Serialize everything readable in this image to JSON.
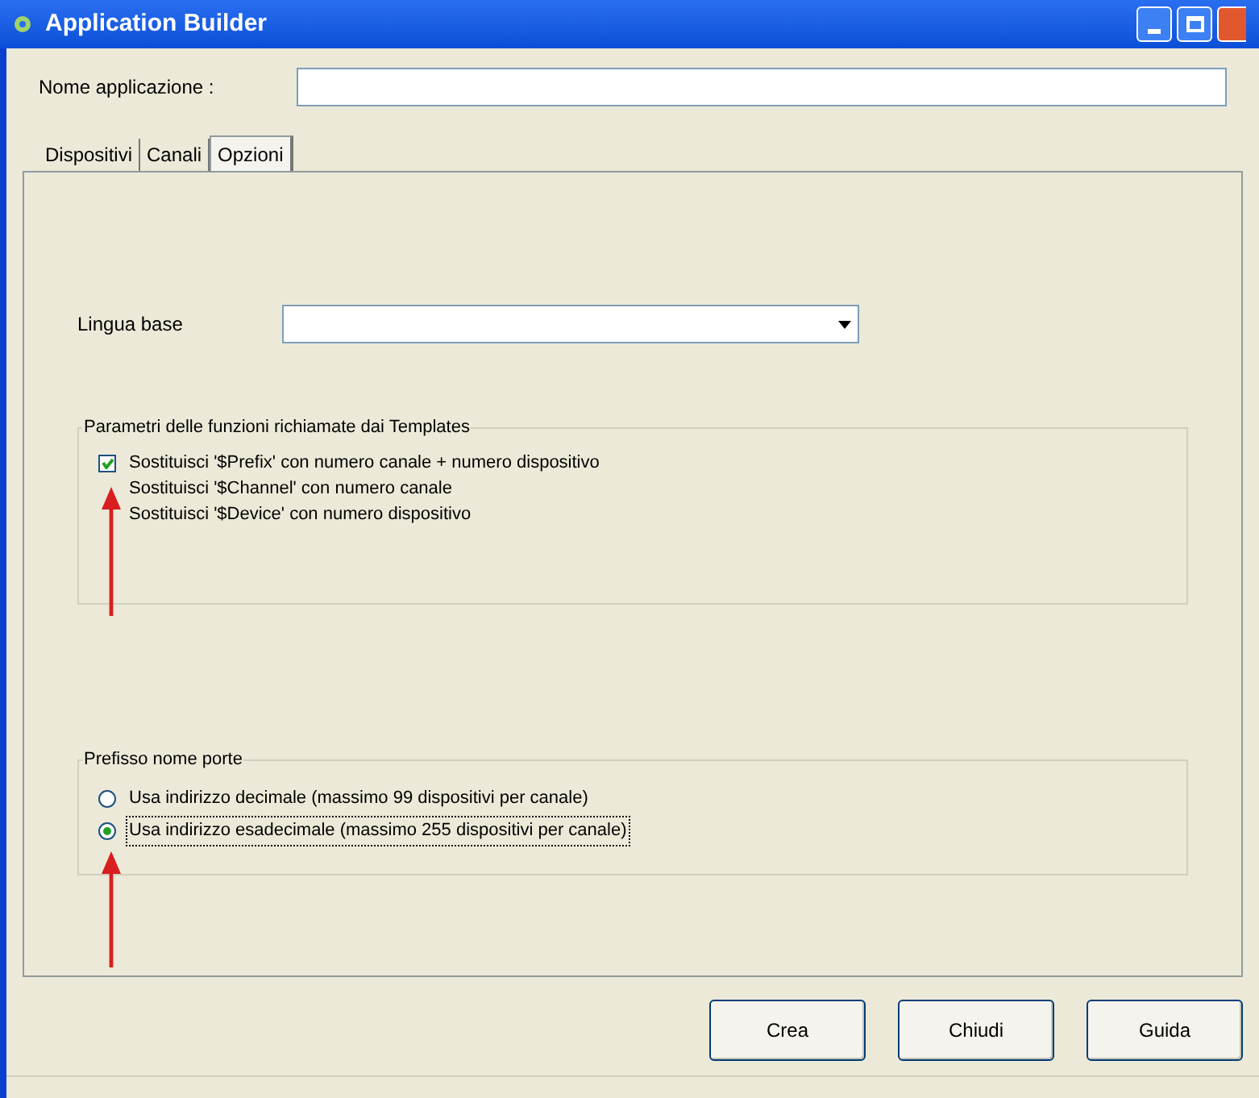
{
  "window": {
    "title": "Application Builder"
  },
  "name_field": {
    "label": "Nome applicazione :"
  },
  "tabs": [
    {
      "label": "Dispositivi",
      "selected": false
    },
    {
      "label": "Canali",
      "selected": false
    },
    {
      "label": "Opzioni",
      "selected": true
    }
  ],
  "language": {
    "label": "Lingua base"
  },
  "template_group": {
    "title": "Parametri delle funzioni richiamate dai Templates",
    "options": [
      {
        "kind": "checkbox",
        "label": "Sostituisci '$Prefix' con numero canale + numero dispositivo",
        "checked": true
      },
      {
        "kind": "label",
        "label": "Sostituisci '$Channel' con numero canale"
      },
      {
        "kind": "label",
        "label": "Sostituisci '$Device' con numero dispositivo"
      }
    ]
  },
  "prefix_group": {
    "title": "Prefisso nome porte",
    "options": [
      {
        "label": "Usa indirizzo decimale (massimo 99 dispositivi per canale)",
        "selected": false
      },
      {
        "label": "Usa indirizzo esadecimale (massimo 255 dispositivi per canale)",
        "selected": true
      }
    ]
  },
  "buttons": [
    "Crea",
    "Chiudi",
    "Guida"
  ]
}
